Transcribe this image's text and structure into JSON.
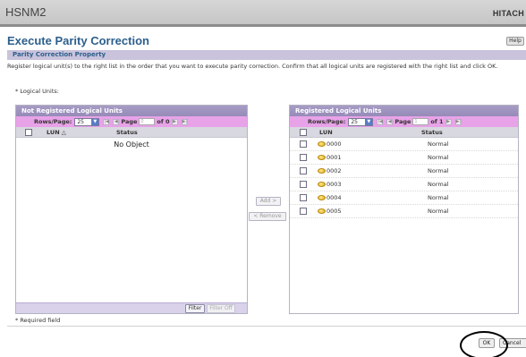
{
  "app": {
    "name": "HSNM2",
    "brand": "HITACH"
  },
  "title": "Execute Parity Correction",
  "help_label": "Help",
  "section_title": "Parity Correction Property",
  "instructions": "Register logical unit(s) to the right list in the order that you want to execute parity correction. Confirm that all logical units are registered with the right list and click OK.",
  "logical_units_label": "* Logical Units:",
  "left_panel": {
    "title": "Not Registered Logical Units",
    "rows_label": "Rows/Page:",
    "rows_value": "25",
    "page_label": "Page",
    "page_input": "0",
    "page_total": "of 0",
    "columns": {
      "lun": "LUN △",
      "status": "Status"
    },
    "empty_text": "No Object",
    "filter_label": "Filter",
    "filter_off_label": "Filter Off"
  },
  "middle": {
    "add_label": "Add >",
    "remove_label": "< Remove"
  },
  "right_panel": {
    "title": "Registered Logical Units",
    "rows_label": "Rows/Page:",
    "rows_value": "25",
    "page_label": "Page",
    "page_input": "1",
    "page_total": "of 1",
    "columns": {
      "lun": "LUN",
      "status": "Status"
    },
    "rows": [
      {
        "lun": "0000",
        "status": "Normal"
      },
      {
        "lun": "0001",
        "status": "Normal"
      },
      {
        "lun": "0002",
        "status": "Normal"
      },
      {
        "lun": "0003",
        "status": "Normal"
      },
      {
        "lun": "0004",
        "status": "Normal"
      },
      {
        "lun": "0005",
        "status": "Normal"
      }
    ]
  },
  "required_note": "* Required field",
  "ok_label": "OK",
  "cancel_label": "Cancel"
}
